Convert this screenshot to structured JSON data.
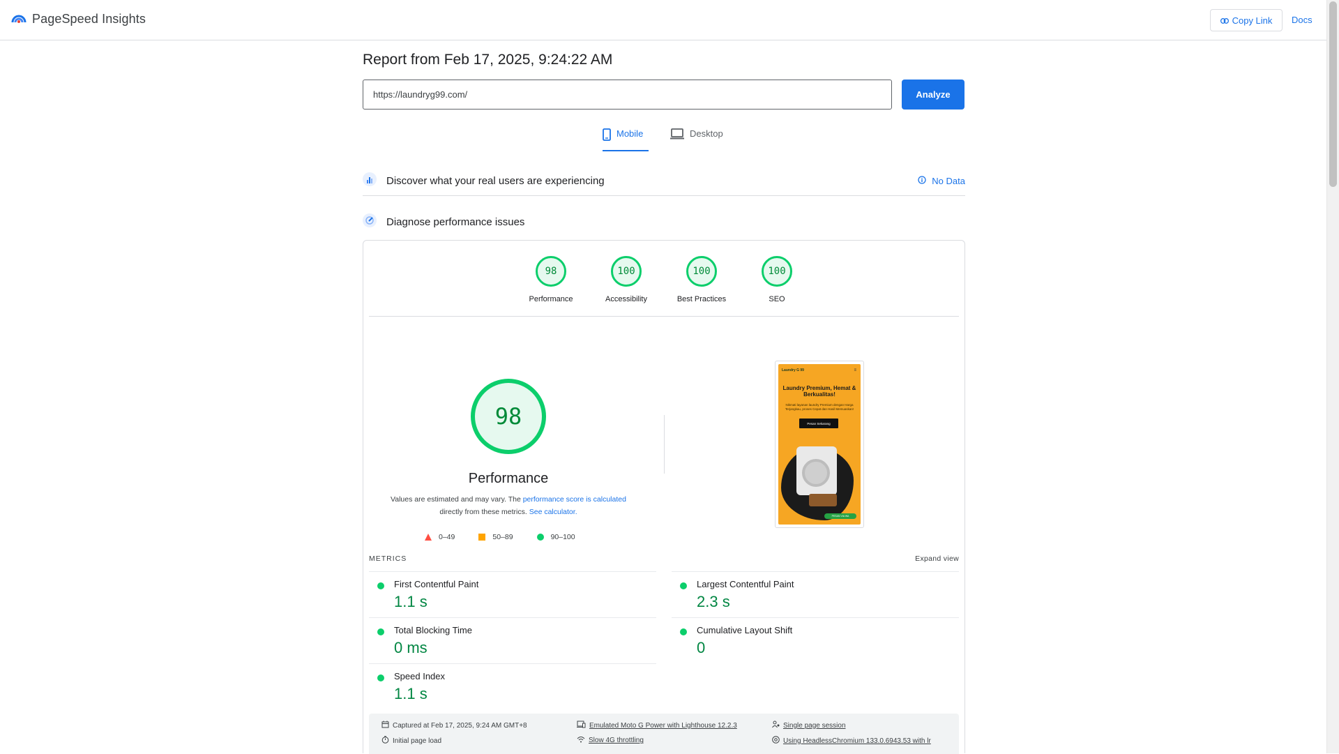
{
  "app": {
    "name": "PageSpeed Insights"
  },
  "header": {
    "copy_link_label": "Copy Link",
    "docs_label": "Docs"
  },
  "report": {
    "title": "Report from Feb 17, 2025, 9:24:22 AM",
    "url_value": "https://laundryg99.com/",
    "analyze_label": "Analyze"
  },
  "tabs": [
    {
      "label": "Mobile",
      "selected": true
    },
    {
      "label": "Desktop",
      "selected": false
    }
  ],
  "sections": {
    "discover": {
      "text": "Discover what your real users are experiencing",
      "status": "No Data"
    },
    "diagnose": {
      "text": "Diagnose performance issues"
    }
  },
  "scores": [
    {
      "label": "Performance",
      "value": "98"
    },
    {
      "label": "Accessibility",
      "value": "100"
    },
    {
      "label": "Best Practices",
      "value": "100"
    },
    {
      "label": "SEO",
      "value": "100"
    }
  ],
  "performance": {
    "score": "98",
    "title": "Performance",
    "desc_before": "Values are estimated and may vary. The ",
    "desc_link1": "performance score is calculated",
    "desc_middle": " directly from these metrics. ",
    "desc_link2": "See calculator.",
    "legend": [
      "0–49",
      "50–89",
      "90–100"
    ]
  },
  "screenshot": {
    "logo": "Laundry G 99",
    "menu": "≡",
    "headline": "Laundry Premium, Hemat & Berkualitas!",
    "sub": "Nikmati layanan laundry Premium dengan Harga Terjangkau, proses Cepat dan Hasil Memuaskan!",
    "cta": "Pesan Sekarang",
    "wa": "PESAN VIA WA"
  },
  "metrics": {
    "heading": "METRICS",
    "expand_label": "Expand view",
    "fcp": {
      "label": "First Contentful Paint",
      "value": "1.1 s"
    },
    "lcp": {
      "label": "Largest Contentful Paint",
      "value": "2.3 s"
    },
    "tbt": {
      "label": "Total Blocking Time",
      "value": "0 ms"
    },
    "cls": {
      "label": "Cumulative Layout Shift",
      "value": "0"
    },
    "si": {
      "label": "Speed Index",
      "value": "1.1 s"
    }
  },
  "footer": {
    "captured": "Captured at Feb 17, 2025, 9:24 AM GMT+8",
    "emulated": "Emulated Moto G Power with Lighthouse 12.2.3",
    "session": "Single page session",
    "load": "Initial page load",
    "throttling": "Slow 4G throttling",
    "browser": "Using HeadlessChromium 133.0.6943.53 with lr"
  },
  "colors": {
    "accent": "#1a73e8",
    "pass": "#0cce6b",
    "pass_text": "#018642",
    "average": "#ffa400",
    "fail": "#ff4e42"
  }
}
